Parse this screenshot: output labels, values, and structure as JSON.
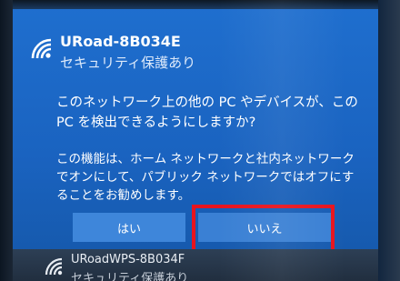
{
  "network": {
    "ssid": "URoad-8B034E",
    "security": "セキュリティ保護あり",
    "icon": "wifi-icon"
  },
  "prompt": {
    "question": "このネットワーク上の他の PC やデバイスが、この PC を検出できるようにしますか?",
    "info": "この機能は、ホーム ネットワークと社内ネットワークでオンにして、パブリック ネットワークではオフにすることをお勧めします。"
  },
  "buttons": {
    "yes_label": "はい",
    "no_label": "いいえ"
  },
  "next_network": {
    "ssid": "URoadWPS-8B034F",
    "security": "セキュリティ保護あり",
    "icon": "wifi-icon"
  },
  "colors": {
    "panel_blue": "#1a63c0",
    "button_blue": "#3e86da",
    "highlight_red": "#e8141e"
  }
}
